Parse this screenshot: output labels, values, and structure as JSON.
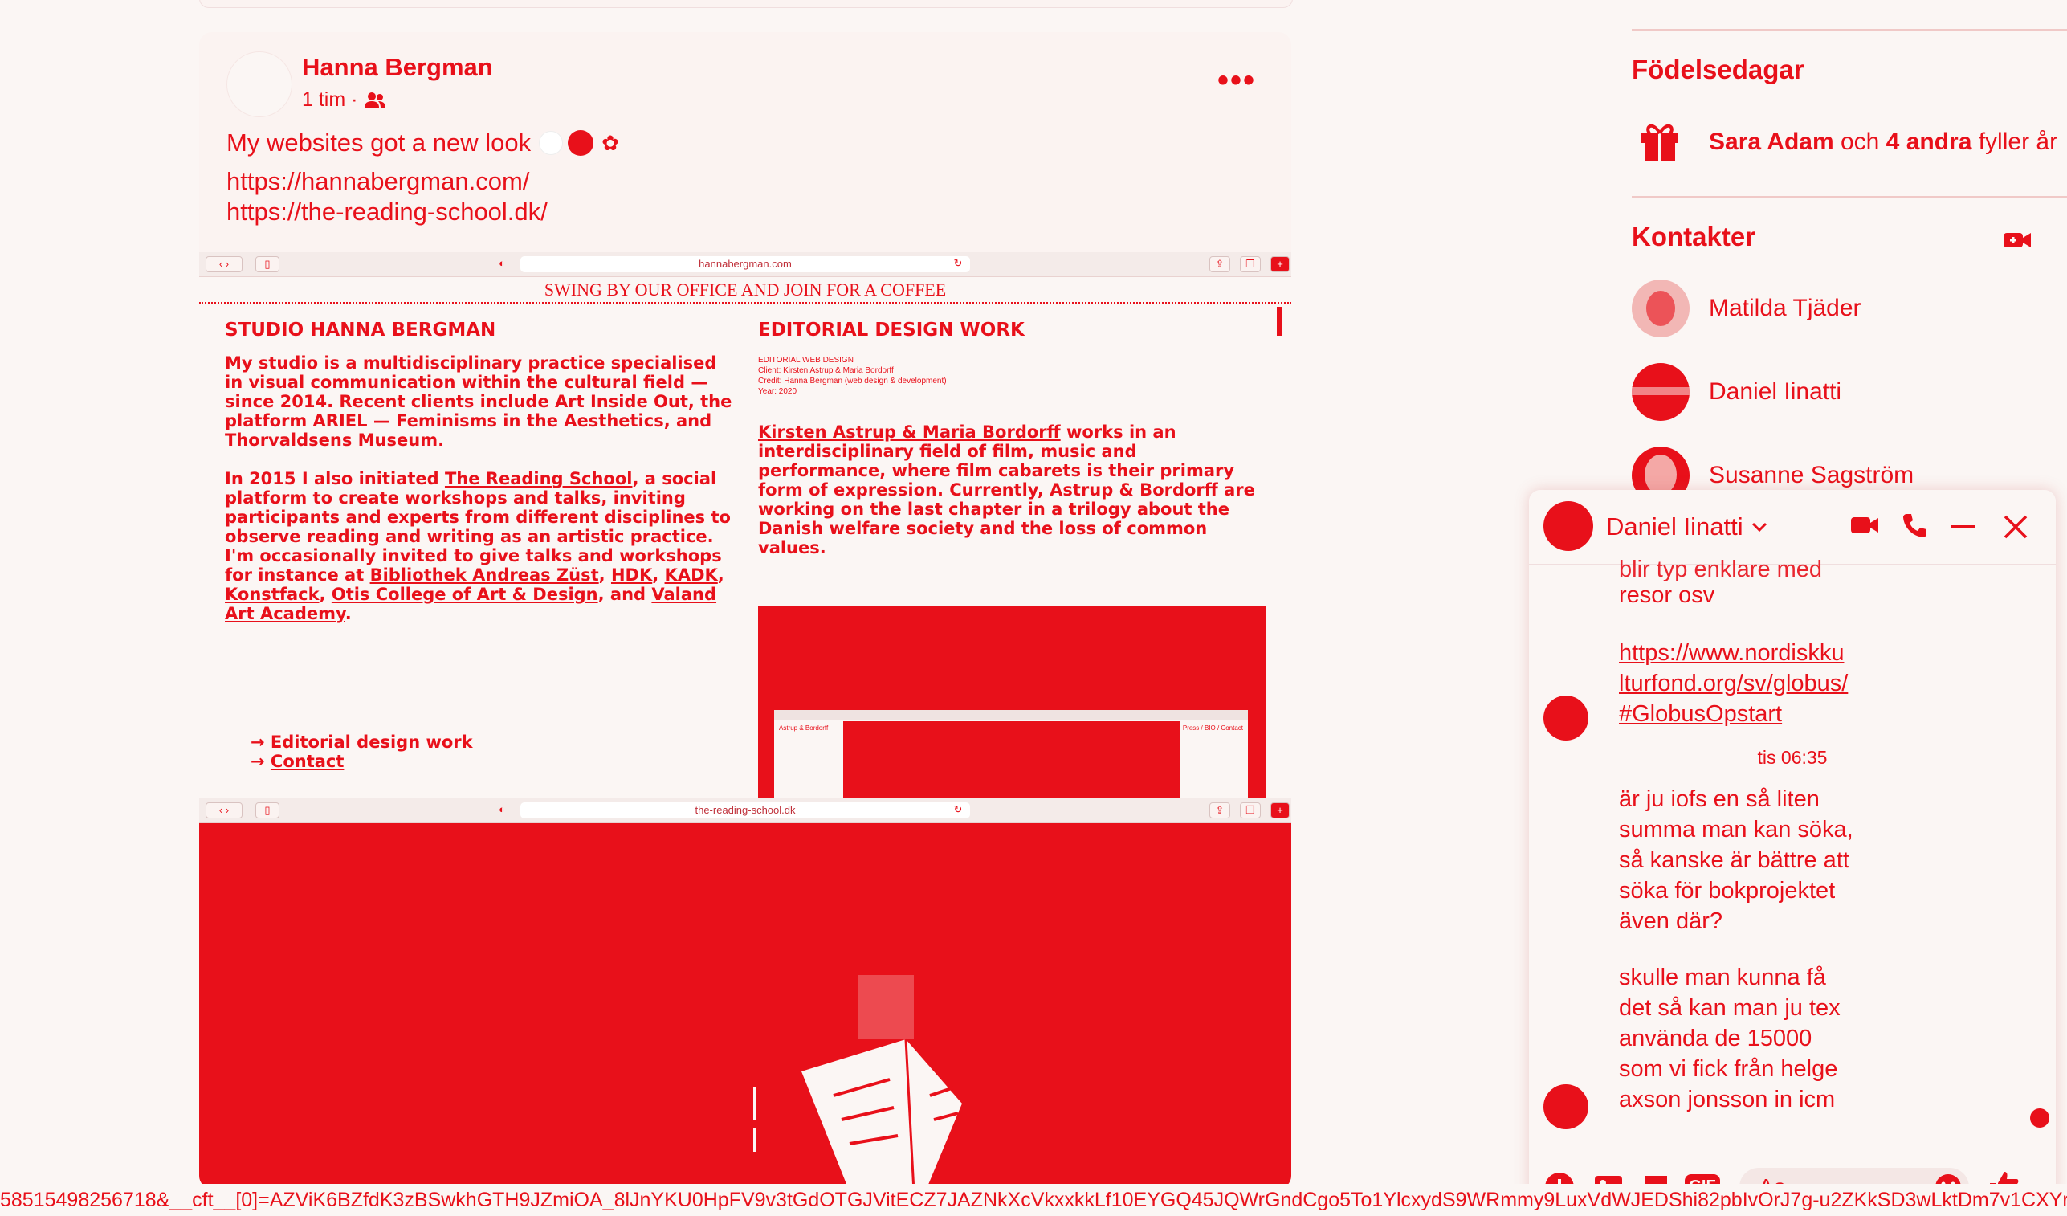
{
  "post": {
    "author": "Hanna Bergman",
    "time": "1 tim ·",
    "text": "My websites got a new look",
    "links": [
      "https://hannabergman.com/",
      "https://the-reading-school.dk/"
    ]
  },
  "shot1": {
    "url": "hannabergman.com",
    "banner": "SWING BY OUR OFFICE AND JOIN FOR A COFFEE",
    "left_heading": "STUDIO HANNA BERGMAN",
    "p1": "My studio is a multidisciplinary practice specialised in visual communication within the cultural field — since 2014. Recent clients include Art Inside Out, the platform ARIEL — Feminisms in the Aesthetics, and Thorvaldsens Museum.",
    "p2_a": "In 2015 I also initiated ",
    "p2_link": "The Reading School",
    "p2_b": ", a social platform to create workshops and talks, inviting participants and experts from different disciplines to observe reading and writing as an artistic practice. I'm occasionally invited to give talks and workshops for instance at ",
    "p2_l1": "Bibliothek Andreas Züst",
    "p2_l2": "HDK",
    "p2_l3": "KADK",
    "p2_l4": "Konstfack",
    "p2_l5": "Otis College of Art & Design",
    "p2_and": ", and ",
    "p2_l6": "Valand Art Academy",
    "nav1": "→ Editorial design work",
    "nav2_arrow": "→ ",
    "nav2": "Contact",
    "right_heading": "EDITORIAL DESIGN WORK",
    "meta": [
      "EDITORIAL WEB DESIGN",
      "Client: Kirsten Astrup & Maria Bordorff",
      "Credit: Hanna Bergman (web design & development)",
      "Year: 2020"
    ],
    "desc_link": "Kirsten Astrup & Maria Bordorff",
    "desc": " works in an interdisciplinary field of film, music and performance, where film cabarets is their primary form of expression. Currently, Astrup & Bordorff are working on the last chapter in a trilogy about the Danish welfare society and the loss of common values.",
    "mini_left": "Astrup & Bordorff",
    "mini_right": "Press / BIO / Contact"
  },
  "shot2": {
    "url": "the-reading-school.dk"
  },
  "sidebar": {
    "birthdays_title": "Födelsedagar",
    "birthday_name": "Sara Adam",
    "birthday_and": " och ",
    "birthday_others": "4 andra",
    "birthday_tail": " fyller år",
    "contacts_title": "Kontakter",
    "contacts": [
      "Matilda Tjäder",
      "Daniel Iinatti",
      "Susanne Sagström"
    ]
  },
  "chat": {
    "name": "Daniel Iinatti",
    "partial": "blir typ enklare med",
    "m1_tail": "resor osv",
    "m1_link": [
      "https://www.nordiskku",
      "lturfond.org/sv/globus/",
      "#GlobusOpstart"
    ],
    "timestamp": "tis 06:35",
    "m2": [
      "är ju iofs en så liten",
      "summa man kan söka,",
      "så kanske är bättre att",
      "söka för bokprojektet",
      "även där?"
    ],
    "m3": [
      "skulle man kunna få",
      "det så kan man ju tex",
      "använda de 15000",
      "som vi fick från helge",
      "axson jonsson in icm"
    ],
    "composer_placeholder": "Aa",
    "gif": "GIF"
  },
  "status_url": "58515498256718&__cft__[0]=AZViK6BZfdK3zBSwkhGTH9JZmiOA_8lJnYKU0HpFV9v3tGdOTGJVitECZ7JAZNkXcVkxxkkLf10EYGQ45JQWrGndCgo5To1YlcxydS9WRmmy9LuxVdWJEDShi82pbIvOrJ7g-u2ZKkSD3wLktDm7v1CXYr",
  "colors": {
    "accent": "#e8101a",
    "background": "#fbf6f4"
  }
}
